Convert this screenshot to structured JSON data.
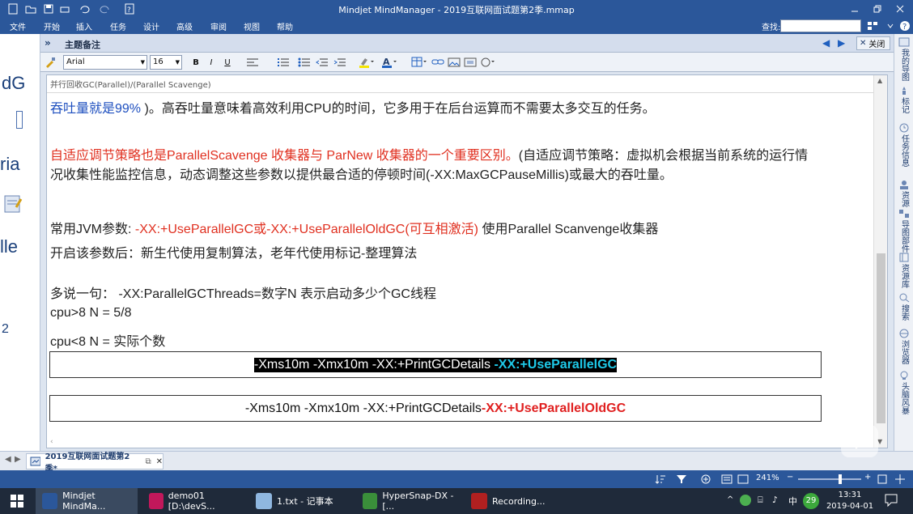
{
  "window": {
    "title": "Mindjet MindManager - 2019互联网面试题第2季.mmap"
  },
  "ribbon": {
    "tabs": [
      "文件",
      "开始",
      "插入",
      "任务",
      "设计",
      "高级",
      "审阅",
      "视图",
      "帮助"
    ],
    "find_label": "查找:",
    "find_value": ""
  },
  "panel": {
    "title": "主题备注",
    "close_label": "关闭",
    "font_name": "Arial",
    "font_size": "16",
    "bold": "B",
    "italic": "I",
    "underline": "U"
  },
  "editor": {
    "topic_title": "并行回收GC(Parallel)/(Parallel Scavenge)",
    "line1_blue": "吞吐量就是99% ",
    "line1_rest": ")。高吞吐量意味着高效利用CPU的时间，它多用于在后台运算而不需要太多交互的任务。",
    "line2_red": "自适应调节策略也是ParallelScavenge 收集器与 ParNew 收集器的一个重要区别。",
    "line2_rest": "(自适应调节策略：虚拟机会根据当前系统的运行情",
    "line3": "况收集性能监控信息，动态调整这些参数以提供最合适的停顿时间(-XX:MaxGCPauseMillis)或最大的吞吐量。",
    "line4_a": "常用JVM参数: ",
    "line4_red": "-XX:+UseParallelGC或-XX:+UseParallelOldGC(可互相激活)",
    "line4_b": "  使用Parallel Scanvenge收集器",
    "line5": "开启该参数后：新生代使用复制算法，老年代使用标记-整理算法",
    "line6": "多说一句：  -XX:ParallelGCThreads=数字N   表示启动多少个GC线程",
    "line7": "cpu>8    N = 5/8",
    "line8": "cpu<8    N = 实际个数",
    "box1_prefix": "-Xms10m -Xmx10m -XX:+PrintGCDetails ",
    "box1_highlight": "-XX:+UseParallelGC",
    "box2_prefix": "-Xms10m -Xmx10m -XX:+PrintGCDetails ",
    "box2_highlight": "-XX:+UseParallelOldGC"
  },
  "left_fragments": [
    "dG",
    "ria",
    "lle",
    "2"
  ],
  "right_tabs": [
    "我的导图",
    "标记",
    "任务信息",
    "资源",
    "导图部件",
    "资源库",
    "搜索",
    "浏览器",
    "头脑风暴"
  ],
  "doc_tab": {
    "label": "2019互联网面试题第2季*"
  },
  "status": {
    "zoom": "241%"
  },
  "taskbar": {
    "items": [
      "Mindjet MindMa...",
      "demo01 [D:\\devS...",
      "1.txt - 记事本",
      "HyperSnap-DX - [...",
      "Recording..."
    ],
    "badge": "29",
    "ime": "中",
    "time": "13:31",
    "date": "2019-04-01"
  },
  "colors": {
    "accent": "#2b579a",
    "red": "#e03020",
    "blue": "#1e4fbf",
    "cyan": "#1ec9e8"
  }
}
